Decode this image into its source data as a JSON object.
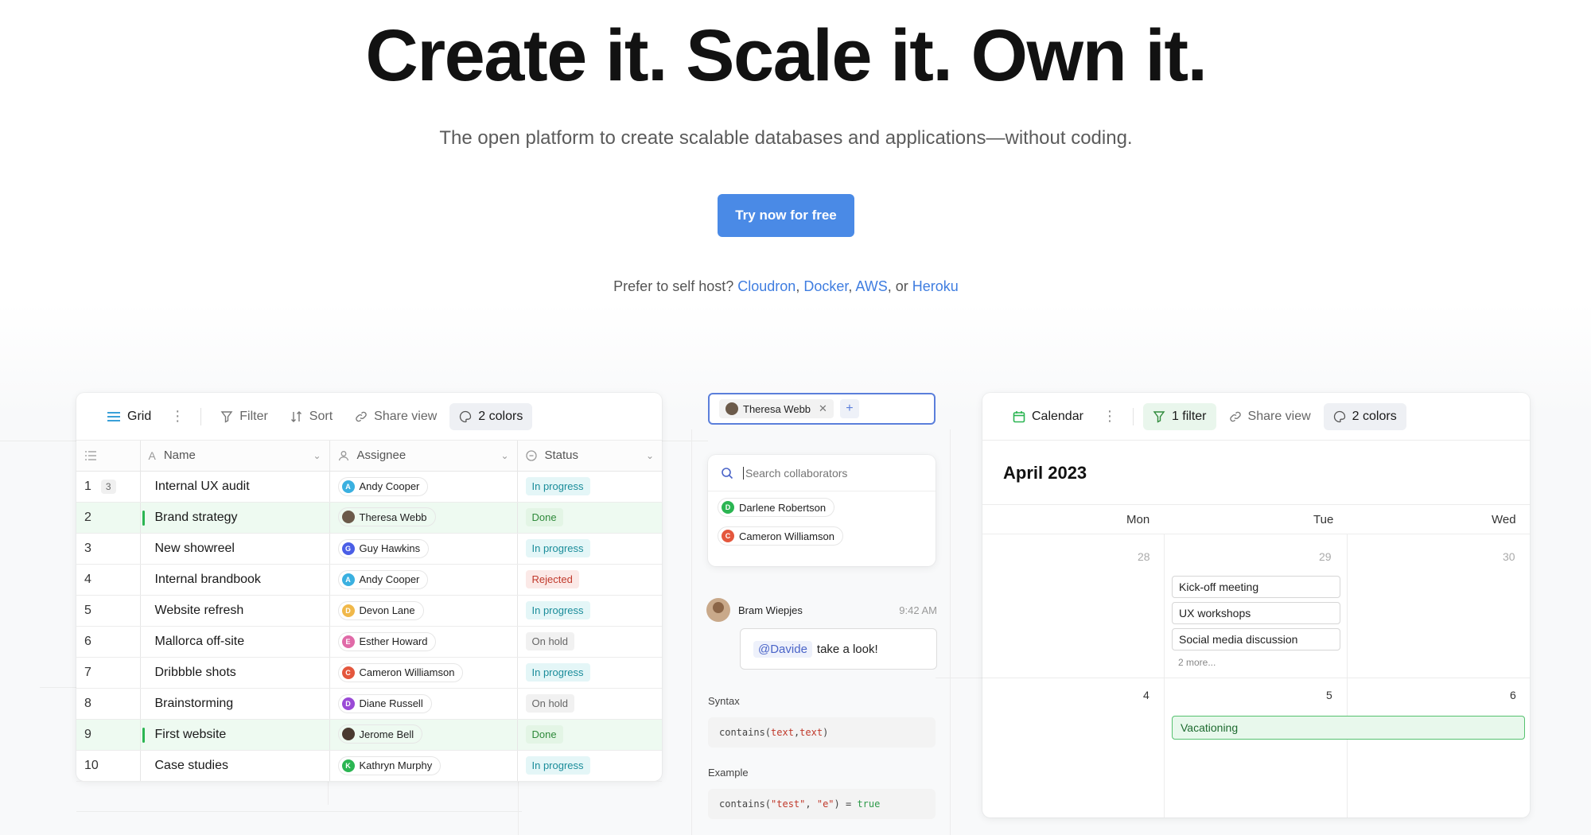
{
  "hero": {
    "title": "Create it. Scale it. Own it.",
    "subtitle": "The open platform to create scalable databases and applications—without coding.",
    "cta": "Try now for free",
    "selfhost_prefix": "Prefer to self host?",
    "links": [
      "Cloudron",
      "Docker",
      "AWS",
      "Heroku"
    ],
    "sep_comma": ",",
    "sep_or": ", or"
  },
  "colors": {
    "accent": "#4a8ae6",
    "link": "#3f7de0",
    "done": "#2f8a3b",
    "progress": "#1a8c9a",
    "rejected": "#c0392b"
  },
  "grid": {
    "toolbar": {
      "view_label": "Grid",
      "filter": "Filter",
      "sort": "Sort",
      "share": "Share view",
      "colors": "2 colors"
    },
    "headers": {
      "name": "Name",
      "assignee": "Assignee",
      "status": "Status"
    },
    "rows": [
      {
        "num": "1",
        "badge": "3",
        "name": "Internal UX audit",
        "assignee": "Andy Cooper",
        "initial": "A",
        "av": "#3ab0e0",
        "status": "In progress",
        "st": "progress",
        "hl": false
      },
      {
        "num": "2",
        "badge": "",
        "name": "Brand strategy",
        "assignee": "Theresa Webb",
        "initial": "",
        "av": "#6b5a4a",
        "status": "Done",
        "st": "done",
        "hl": true
      },
      {
        "num": "3",
        "badge": "",
        "name": "New showreel",
        "assignee": "Guy Hawkins",
        "initial": "G",
        "av": "#4a5ee6",
        "status": "In progress",
        "st": "progress",
        "hl": false
      },
      {
        "num": "4",
        "badge": "",
        "name": "Internal brandbook",
        "assignee": "Andy Cooper",
        "initial": "A",
        "av": "#3ab0e0",
        "status": "Rejected",
        "st": "rejected",
        "hl": false
      },
      {
        "num": "5",
        "badge": "",
        "name": "Website refresh",
        "assignee": "Devon Lane",
        "initial": "D",
        "av": "#f0b84a",
        "status": "In progress",
        "st": "progress",
        "hl": false
      },
      {
        "num": "6",
        "badge": "",
        "name": "Mallorca off-site",
        "assignee": "Esther Howard",
        "initial": "E",
        "av": "#e06aa8",
        "status": "On hold",
        "st": "hold",
        "hl": false
      },
      {
        "num": "7",
        "badge": "",
        "name": "Dribbble shots",
        "assignee": "Cameron Williamson",
        "initial": "C",
        "av": "#e4573d",
        "status": "In progress",
        "st": "progress",
        "hl": false
      },
      {
        "num": "8",
        "badge": "",
        "name": "Brainstorming",
        "assignee": "Diane Russell",
        "initial": "D",
        "av": "#9a4ad6",
        "status": "On hold",
        "st": "hold",
        "hl": false
      },
      {
        "num": "9",
        "badge": "",
        "name": "First website",
        "assignee": "Jerome Bell",
        "initial": "",
        "av": "#4a3a30",
        "status": "Done",
        "st": "done",
        "hl": true
      },
      {
        "num": "10",
        "badge": "",
        "name": "Case studies",
        "assignee": "Kathryn Murphy",
        "initial": "K",
        "av": "#2bb552",
        "status": "In progress",
        "st": "progress",
        "hl": false
      }
    ]
  },
  "collab": {
    "chip": "Theresa Webb",
    "search_placeholder": "Search collaborators",
    "people": [
      {
        "name": "Darlene Robertson",
        "initial": "D",
        "av": "#2bb552"
      },
      {
        "name": "Cameron Williamson",
        "initial": "C",
        "av": "#e4573d"
      }
    ]
  },
  "comment": {
    "author": "Bram Wiepjes",
    "time": "9:42 AM",
    "mention": "@Davide",
    "text": "take a look!"
  },
  "formula": {
    "syntax_label": "Syntax",
    "syntax_fn": "contains(",
    "syntax_arg1": "text",
    "syntax_comma": ",",
    "syntax_arg2": "text",
    "syntax_close": ")",
    "example_label": "Example",
    "ex_fn": "contains(",
    "ex_arg1": "\"test\"",
    "ex_comma": ", ",
    "ex_arg2": "\"e\"",
    "ex_eq": ") = ",
    "ex_result": "true"
  },
  "calendar": {
    "toolbar": {
      "view_label": "Calendar",
      "filter": "1 filter",
      "share": "Share view",
      "colors": "2 colors"
    },
    "month": "April 2023",
    "days": [
      "Mon",
      "Tue",
      "Wed"
    ],
    "week1": [
      "28",
      "29",
      "30"
    ],
    "week2": [
      "4",
      "5",
      "6"
    ],
    "events": [
      "Kick-off meeting",
      "UX workshops",
      "Social media discussion"
    ],
    "more": "2 more...",
    "vacation": "Vacationing"
  }
}
